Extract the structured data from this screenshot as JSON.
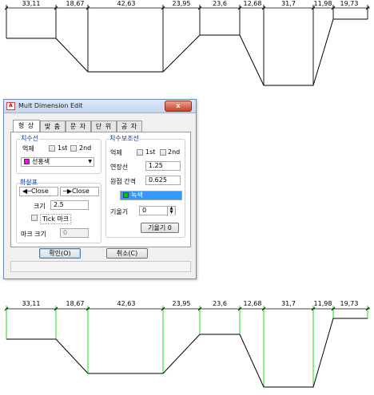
{
  "drawing_top": {
    "dimensions": [
      "33,11",
      "18,67",
      "42,63",
      "23,95",
      "23,6",
      "12,68",
      "31,7",
      "11,98",
      "19,73"
    ]
  },
  "drawing_bottom": {
    "dimensions": [
      "33,11",
      "18,67",
      "42,63",
      "23,95",
      "23,6",
      "12,68",
      "31,7",
      "11,98",
      "19,73"
    ]
  },
  "dialog": {
    "app_icon": "A",
    "title": "Mult Dimension Edit",
    "close_label": "x",
    "tabs": [
      "형 상",
      "맞 춤",
      "문 자",
      "단 위",
      "공 차"
    ],
    "dim_line": {
      "title": "치수선",
      "suppress_label": "억제",
      "first_label": "1st",
      "second_label": "2nd",
      "color_value": "선홍색",
      "color_hex": "#ff00ff"
    },
    "arrows": {
      "title": "화살표",
      "first_value": "Close",
      "second_value": "Close",
      "size_label": "크기",
      "size_value": "2.5",
      "tick_label": "Tick 마크",
      "mark_size_label": "마크 크기",
      "mark_size_value": "0"
    },
    "ext_line": {
      "title": "치수보조선",
      "suppress_label": "억제",
      "first_label": "1st",
      "second_label": "2nd",
      "extension_label": "연장선",
      "extension_value": "1.25",
      "offset_label": "원점 간격",
      "offset_value": "0.625",
      "color_value": "녹색",
      "color_hex": "#00c800",
      "oblique_label": "기울기",
      "oblique_value": "0",
      "oblique_zero_button": "기울기 0"
    },
    "ok_button": "확인(O)",
    "cancel_button": "취소(C)"
  },
  "colors": {
    "extension_line_bottom": "#00e000",
    "dimension_line": "#000000",
    "selection_highlight": "#3399ff"
  }
}
